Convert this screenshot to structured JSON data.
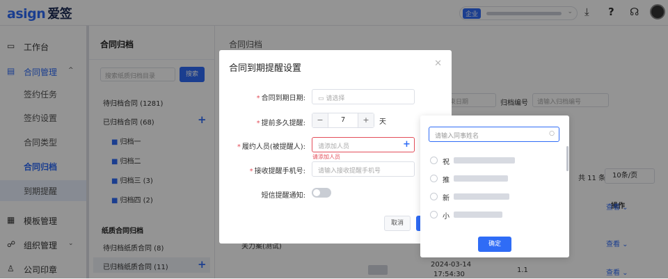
{
  "header": {
    "logo_text": "asign",
    "logo_cn": "爱签",
    "corp_tag": "企业",
    "icons": [
      "download-icon",
      "help-icon",
      "headset-icon"
    ],
    "icon_glyphs": [
      "⤓",
      "?",
      "☊"
    ]
  },
  "sidebar": {
    "items": [
      {
        "label": "工作台",
        "icon": "dashboard-icon",
        "glyph": "▭"
      },
      {
        "label": "合同管理",
        "icon": "contract-icon",
        "glyph": "▤",
        "chevron": "^"
      },
      {
        "label": "模板管理",
        "icon": "template-icon",
        "glyph": "▦"
      },
      {
        "label": "组织管理",
        "icon": "org-icon",
        "glyph": "☍",
        "chevron": "⌄"
      },
      {
        "label": "公司印章",
        "icon": "seal-icon",
        "glyph": "♙"
      }
    ],
    "sub_items": [
      "签约任务",
      "签约设置",
      "合同类型",
      "合同归档",
      "到期提醒"
    ],
    "active_sub": "合同归档"
  },
  "archive": {
    "title": "合同归档",
    "search_placeholder": "搜索纸质归档目录",
    "search_button": "搜索",
    "pending": "待归档合同 (1281)",
    "archived": "已归档合同 (68)",
    "folders": [
      "归档一",
      "归档二",
      "归档三 (3)",
      "归档四 (2)"
    ],
    "paper_heading": "纸质合同归档",
    "paper_pending": "待归档纸质合同 (8)",
    "paper_archived": "已归档纸质合同 (11)"
  },
  "main": {
    "title": "合同归档",
    "filter_date_placeholder": "束日期",
    "filter_no_label": "归档编号",
    "filter_no_placeholder": "请输入归档编号",
    "total": "共 11 条",
    "page_size": "10条/页",
    "col_op": "操作",
    "view_label": "查看",
    "row_text": "关力案(测试)",
    "row_date": "2024-03-14",
    "row_time": "17:54:30",
    "row_ver": "1.1"
  },
  "modal": {
    "title": "合同到期提醒设置",
    "expiry_label": "合同到期日期:",
    "expiry_placeholder": "请选择",
    "advance_label": "提前多久提醒:",
    "advance_value": "7",
    "advance_unit": "天",
    "signer_label": "履约人员(被提醒人):",
    "signer_placeholder": "请添加人员",
    "signer_error": "请添加人员",
    "phone_label": "接收提醒手机号:",
    "phone_placeholder": "请输入接收提醒手机号",
    "sms_label": "短信提醒通知:",
    "cancel": "取消"
  },
  "picker": {
    "search_placeholder": "请输入同事姓名",
    "items": [
      "祝",
      "推",
      "新",
      "小"
    ],
    "ok": "确定"
  }
}
